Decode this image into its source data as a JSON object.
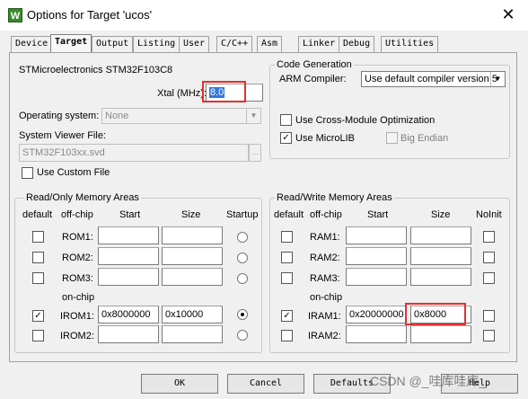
{
  "window": {
    "title": "Options for Target 'ucos'",
    "icon_letter": "W",
    "close_glyph": "✕"
  },
  "tabs": [
    {
      "label": "Device",
      "active": false
    },
    {
      "label": "Target",
      "active": true
    },
    {
      "label": "Output",
      "active": false
    },
    {
      "label": "Listing",
      "active": false
    },
    {
      "label": "User",
      "active": false
    },
    {
      "label": "C/C++",
      "active": false
    },
    {
      "label": "Asm",
      "active": false
    },
    {
      "label": "Linker",
      "active": false
    },
    {
      "label": "Debug",
      "active": false
    },
    {
      "label": "Utilities",
      "active": false
    }
  ],
  "target": {
    "device_name": "STMicroelectronics STM32F103C8",
    "xtal_label": "Xtal (MHz):",
    "xtal_value": "8.0",
    "os_label": "Operating system:",
    "os_value": "None",
    "svf_label": "System Viewer File:",
    "svf_value": "STM32F103xx.svd",
    "browse_glyph": "...",
    "custom_file_label": "Use Custom File"
  },
  "code_gen": {
    "title": "Code Generation",
    "compiler_label": "ARM Compiler:",
    "compiler_value": "Use default compiler version 5",
    "cross_module_label": "Use Cross-Module Optimization",
    "microlib_label": "Use MicroLIB",
    "microlib_checked": true,
    "big_endian_label": "Big Endian"
  },
  "ro_memory": {
    "title": "Read/Only Memory Areas",
    "headers": {
      "default": "default",
      "offchip": "off-chip",
      "start": "Start",
      "size": "Size",
      "extra": "Startup"
    },
    "onchip_label": "on-chip",
    "rows": [
      {
        "name": "ROM1:",
        "start": "",
        "size": "",
        "default": false
      },
      {
        "name": "ROM2:",
        "start": "",
        "size": "",
        "default": false
      },
      {
        "name": "ROM3:",
        "start": "",
        "size": "",
        "default": false
      },
      {
        "name": "IROM1:",
        "start": "0x8000000",
        "size": "0x10000",
        "default": true
      },
      {
        "name": "IROM2:",
        "start": "",
        "size": "",
        "default": false
      }
    ]
  },
  "rw_memory": {
    "title": "Read/Write Memory Areas",
    "headers": {
      "default": "default",
      "offchip": "off-chip",
      "start": "Start",
      "size": "Size",
      "extra": "NoInit"
    },
    "onchip_label": "on-chip",
    "rows": [
      {
        "name": "RAM1:",
        "start": "",
        "size": "",
        "default": false
      },
      {
        "name": "RAM2:",
        "start": "",
        "size": "",
        "default": false
      },
      {
        "name": "RAM3:",
        "start": "",
        "size": "",
        "default": false
      },
      {
        "name": "IRAM1:",
        "start": "0x20000000",
        "size": "0x8000",
        "default": true
      },
      {
        "name": "IRAM2:",
        "start": "",
        "size": "",
        "default": false
      }
    ]
  },
  "check_glyph": "✓",
  "buttons": {
    "ok": "OK",
    "cancel": "Cancel",
    "defaults": "Defaults",
    "help": "Help"
  },
  "watermark": "CSDN @_哇库哇库_",
  "colors": {
    "highlight": "#e03030",
    "selection": "#3377dd"
  }
}
